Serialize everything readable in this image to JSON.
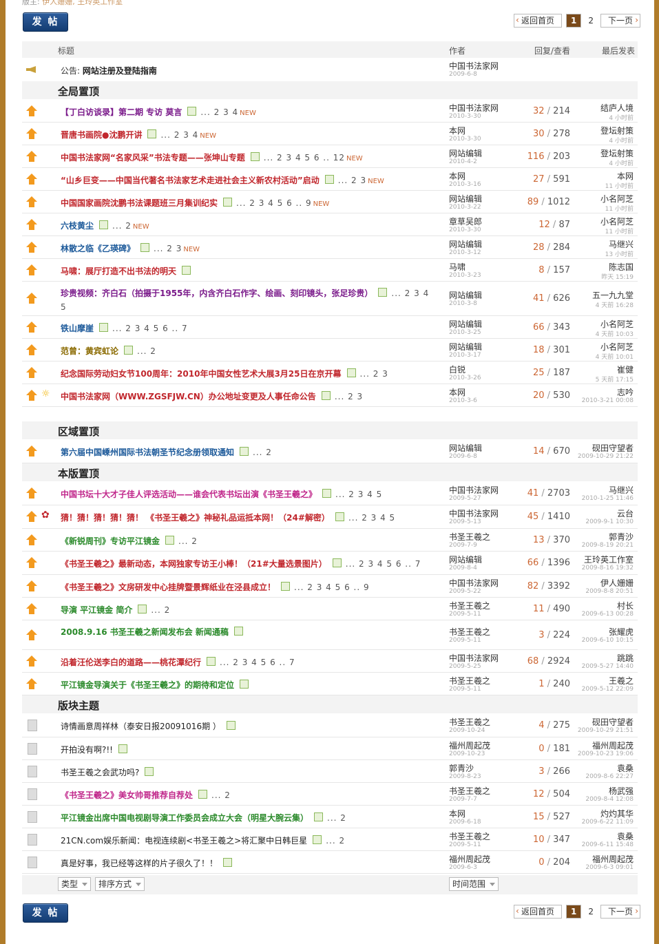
{
  "header": {
    "moderators_label": "版主:",
    "moderators": "伊人姗姗, 王玲英工作室"
  },
  "post_button": "发 帖",
  "pager": {
    "back": "返回首页",
    "current": "1",
    "page2": "2",
    "next": "下一页"
  },
  "columns": {
    "title": "标题",
    "author": "作者",
    "stats": "回复/查看",
    "last": "最后发表"
  },
  "announcement": {
    "label": "公告:",
    "title": "网站注册及登陆指南",
    "author": "中国书法家网",
    "date": "2009-6-8"
  },
  "sections": {
    "global": "全局置顶",
    "region": "区域置顶",
    "local": "本版置顶",
    "normal": "版块主题"
  },
  "global_threads": [
    {
      "title": "【丁白访谈录】第二期 专访 莫言",
      "pages": "... 2 3 4",
      "new": "NEW",
      "author": "中国书法家网",
      "date": "2010-3-30",
      "replies": "32",
      "views": "214",
      "last_user": "结庐人境",
      "last_time": "4 小时前"
    },
    {
      "title": "晋唐书画院●沈鹏开讲",
      "pages": "... 2 3 4",
      "new": "NEW",
      "author": "本网",
      "date": "2010-3-30",
      "replies": "30",
      "views": "278",
      "last_user": "登坛射策",
      "last_time": "4 小时前"
    },
    {
      "title": "中国书法家网“名家风采”书法专题——张坤山专题",
      "pages": "... 2 3 4 5 6 .. 12",
      "new": "NEW",
      "author": "网站编辑",
      "date": "2010-4-2",
      "replies": "116",
      "views": "203",
      "last_user": "登坛射策",
      "last_time": "4 小时前"
    },
    {
      "title": "“山乡巨变——中国当代著名书法家艺术走进社会主义新农村活动”启动",
      "pages": "... 2 3",
      "new": "NEW",
      "author": "本网",
      "date": "2010-3-16",
      "replies": "27",
      "views": "591",
      "last_user": "本网",
      "last_time": "11 小时前"
    },
    {
      "title": "中国国家画院沈鹏书法课题班三月集训纪实",
      "pages": "... 2 3 4 5 6 .. 9",
      "new": "NEW",
      "author": "网站编辑",
      "date": "2010-3-22",
      "replies": "89",
      "views": "1012",
      "last_user": "小名阿芝",
      "last_time": "11 小时前"
    },
    {
      "title": "六枝黄尘",
      "pages": "... 2",
      "new": "NEW",
      "author": "章草吴郎",
      "date": "2010-3-30",
      "replies": "12",
      "views": "87",
      "last_user": "小名阿芝",
      "last_time": "11 小时前"
    },
    {
      "title": "林散之临《乙瑛碑》",
      "pages": "... 2 3",
      "new": "NEW",
      "author": "网站编辑",
      "date": "2010-3-12",
      "replies": "28",
      "views": "284",
      "last_user": "马继兴",
      "last_time": "13 小时前"
    },
    {
      "title": "马啸：展厅打造不出书法的明天",
      "pages": "",
      "new": "",
      "author": "马啸",
      "date": "2010-3-23",
      "replies": "8",
      "views": "157",
      "last_user": "陈志国",
      "last_time": "昨天 15:19"
    },
    {
      "title": "珍贵视频：齐白石（拍摄于1955年，内含齐白石作字、绘画、刻印镜头，张足珍贵）",
      "pages": "... 2 3 4 5",
      "new": "",
      "author": "网站编辑",
      "date": "2010-3-8",
      "replies": "41",
      "views": "626",
      "last_user": "五一九九堂",
      "last_time": "4 天前 16:28"
    },
    {
      "title": "铁山摩崖",
      "pages": "... 2 3 4 5 6 .. 7",
      "new": "",
      "author": "网站编辑",
      "date": "2010-3-25",
      "replies": "66",
      "views": "343",
      "last_user": "小名阿芝",
      "last_time": "4 天前 10:03"
    },
    {
      "title": "范曾：黄宾虹论",
      "pages": "... 2",
      "new": "",
      "author": "网站编辑",
      "date": "2010-3-17",
      "replies": "18",
      "views": "301",
      "last_user": "小名阿芝",
      "last_time": "4 天前 10:01"
    },
    {
      "title": "纪念国际劳动妇女节100周年：2010年中国女性艺术大展3月25日在京开幕",
      "pages": "... 2 3",
      "new": "",
      "author": "白锐",
      "date": "2010-3-26",
      "replies": "25",
      "views": "187",
      "last_user": "崔健",
      "last_time": "5 天前 17:15"
    },
    {
      "title": "中国书法家网（WWW.ZGSFJW.CN）办公地址变更及人事任命公告",
      "pages": "... 2 3",
      "new": "",
      "author": "本网",
      "date": "2010-3-6",
      "replies": "20",
      "views": "530",
      "last_user": "志吟",
      "last_time": "2010-3-21 00:08"
    }
  ],
  "region_threads": [
    {
      "title": "第六届中国嵊州国际书法朝圣节纪念册领取通知",
      "pages": "... 2",
      "author": "网站编辑",
      "date": "2009-6-8",
      "replies": "14",
      "views": "670",
      "last_user": "砚田守望者",
      "last_time": "2009-10-29 21:22"
    }
  ],
  "local_threads": [
    {
      "title": "中国书坛十大才子佳人评选活动——谁会代表书坛出演《书圣王羲之》",
      "pages": "... 2 3 4 5",
      "author": "中国书法家网",
      "date": "2009-5-27",
      "replies": "41",
      "views": "2703",
      "last_user": "马继兴",
      "last_time": "2010-1-25 11:46"
    },
    {
      "title": "猜！猜！猜！猜！猜！ 《书圣王羲之》神秘礼品运抵本网！（24#解密）",
      "pages": "... 2 3 4 5",
      "author": "中国书法家网",
      "date": "2009-5-13",
      "replies": "45",
      "views": "1410",
      "last_user": "云台",
      "last_time": "2009-9-1 10:30"
    },
    {
      "title": "《新锐周刊》专访平江镜金",
      "pages": "... 2",
      "author": "书圣王羲之",
      "date": "2009-7-9",
      "replies": "13",
      "views": "370",
      "last_user": "郭青沙",
      "last_time": "2009-8-19 20:21"
    },
    {
      "title": "《书圣王羲之》最新动态，本网独家专访王小棒！（21#大量选景图片）",
      "pages": "... 2 3 4 5 6 .. 7",
      "author": "网站编辑",
      "date": "2009-8-4",
      "replies": "66",
      "views": "1396",
      "last_user": "王玲英工作室",
      "last_time": "2009-8-16 19:32"
    },
    {
      "title": "《书圣王羲之》文房研发中心挂牌暨景辉纸业在泾县成立！",
      "pages": "... 2 3 4 5 6 .. 9",
      "author": "中国书法家网",
      "date": "2009-5-22",
      "replies": "82",
      "views": "3392",
      "last_user": "伊人姗姗",
      "last_time": "2009-8-8 20:51"
    },
    {
      "title": "导演 平江镜金 简介",
      "pages": "... 2",
      "author": "书圣王羲之",
      "date": "2009-5-11",
      "replies": "11",
      "views": "490",
      "last_user": "村长",
      "last_time": "2009-6-13 00:28"
    },
    {
      "title": "2008.9.16 书圣王羲之新闻发布会 新闻通稿",
      "pages": "",
      "author": "书圣王羲之",
      "date": "2009-5-11",
      "replies": "3",
      "views": "224",
      "last_user": "张耀虎",
      "last_time": "2009-6-10 10:15"
    },
    {
      "title": "沿着汪伦送李白的道路——桃花潭纪行",
      "pages": "... 2 3 4 5 6 .. 7",
      "author": "中国书法家网",
      "date": "2009-5-25",
      "replies": "68",
      "views": "2924",
      "last_user": "跳跳",
      "last_time": "2009-5-27 14:40"
    },
    {
      "title": "平江镜金导演关于《书圣王羲之》的期待和定位",
      "pages": "",
      "author": "书圣王羲之",
      "date": "2009-5-11",
      "replies": "1",
      "views": "240",
      "last_user": "王羲之",
      "last_time": "2009-5-12 22:09"
    }
  ],
  "normal_threads": [
    {
      "title": "诗情画意周祥林（泰安日报20091016期 ）",
      "pages": "",
      "author": "书圣王羲之",
      "date": "2009-10-24",
      "replies": "4",
      "views": "275",
      "last_user": "砚田守望者",
      "last_time": "2009-10-29 21:51"
    },
    {
      "title": "开拍没有啊?!!",
      "pages": "",
      "author": "福州周起茂",
      "date": "2009-10-23",
      "replies": "0",
      "views": "181",
      "last_user": "福州周起茂",
      "last_time": "2009-10-23 19:06"
    },
    {
      "title": "书圣王羲之会武功吗?",
      "pages": "",
      "author": "郭青沙",
      "date": "2009-8-23",
      "replies": "3",
      "views": "266",
      "last_user": "袁桑",
      "last_time": "2009-8-6 22:27"
    },
    {
      "title": "《书圣王羲之》美女帅哥推荐自荐处",
      "pages": "... 2",
      "author": "书圣王羲之",
      "date": "2009-7-7",
      "replies": "12",
      "views": "504",
      "last_user": "杨武强",
      "last_time": "2009-8-4 12:08"
    },
    {
      "title": "平江镜金出席中国电视剧导演工作委员会成立大会（明星大腕云集）",
      "pages": "... 2",
      "author": "本网",
      "date": "2009-6-18",
      "replies": "15",
      "views": "527",
      "last_user": "灼灼其华",
      "last_time": "2009-6-22 11:09"
    },
    {
      "title": "21CN.com娱乐新闻：电视连续剧<书圣王羲之>将汇聚中日韩巨星",
      "pages": "... 2",
      "author": "书圣王羲之",
      "date": "2009-5-11",
      "replies": "10",
      "views": "347",
      "last_user": "袁桑",
      "last_time": "2009-6-11 15:48"
    },
    {
      "title": "真是好事，我已经等这样的片子很久了！！",
      "pages": "",
      "author": "福州周起茂",
      "date": "2009-6-3",
      "replies": "0",
      "views": "204",
      "last_user": "福州周起茂",
      "last_time": "2009-6-3 09:01"
    }
  ],
  "filters": {
    "type": "类型",
    "sort": "排序方式",
    "time": "时间范围"
  },
  "colors": {
    "accent": "#7a4a1a",
    "button": "#1d4a85",
    "arrow": "#f39a1e",
    "reply": "#c63"
  }
}
